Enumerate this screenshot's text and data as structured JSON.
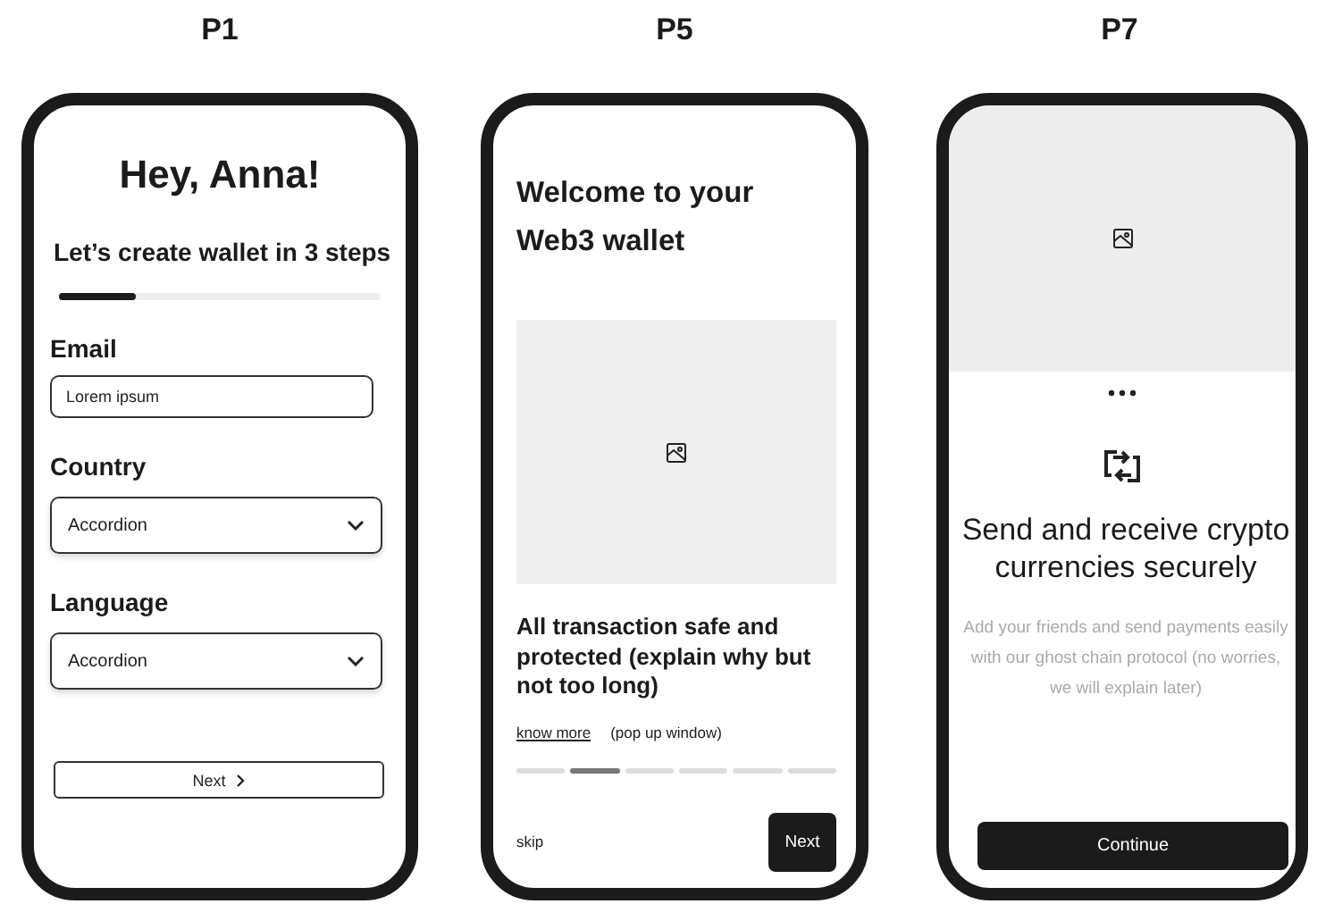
{
  "screens": [
    {
      "kind": "signup",
      "label": "P1",
      "title": "Hey, Anna!",
      "subtitle": "Let’s create wallet in 3 steps",
      "progress": {
        "level": 0.24
      },
      "fields": [
        {
          "kind": "text",
          "label": "Email",
          "placeholder": "Lorem ipsum"
        },
        {
          "kind": "select",
          "label": "Country",
          "value": "Accordion"
        },
        {
          "kind": "select",
          "label": "Language",
          "value": "Accordion"
        }
      ],
      "button": "Next"
    },
    {
      "kind": "intro",
      "label": "P5",
      "title": "Welcome to your Web3 wallet",
      "body": "All transaction safe and protected (explain why but not too long)",
      "link": "know more",
      "note": "(pop up window)",
      "pager": [
        {
          "selected": false
        },
        {
          "selected": true
        },
        {
          "selected": false
        },
        {
          "selected": false
        },
        {
          "selected": false
        },
        {
          "selected": false
        }
      ],
      "skip": "skip",
      "button": "Next"
    },
    {
      "kind": "feature",
      "label": "P7",
      "title": "Send and receive crypto currencies securely",
      "body": "Add your friends and send payments easily with our ghost chain protocol (no worries, we will explain later)",
      "button": "Continue"
    }
  ]
}
